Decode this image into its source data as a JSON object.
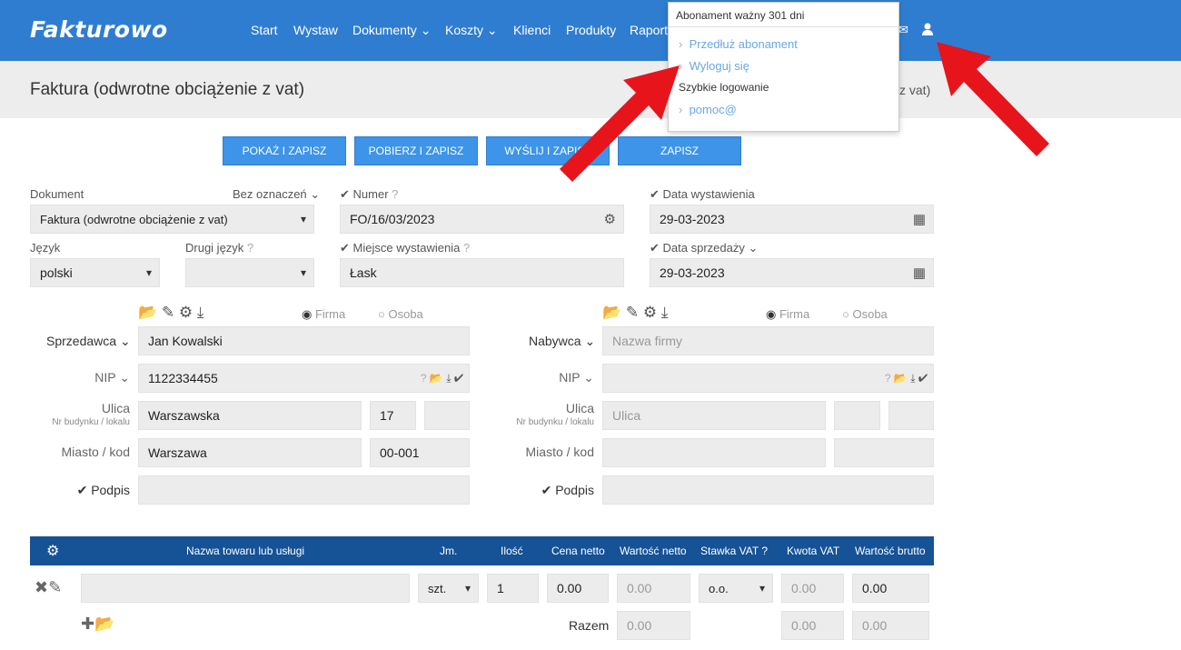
{
  "nav": {
    "logo": "Fakturowo",
    "items": [
      "Start",
      "Wystaw",
      "Dokumenty",
      "Koszty",
      "Klienci",
      "Produkty",
      "Raporty"
    ]
  },
  "page": {
    "title": "Faktura (odwrotne obciążenie z vat)",
    "title_right": "z vat)"
  },
  "buttons": {
    "show_save": "POKAŻ I ZAPISZ",
    "download_save": "POBIERZ I ZAPISZ",
    "send_save": "WYŚLIJ I ZAPISZ",
    "save": "ZAPISZ"
  },
  "form": {
    "dokument_label": "Dokument",
    "bez_oznaczen": "Bez oznaczeń",
    "dokument_value": "Faktura (odwrotne obciążenie z vat)",
    "jezyk_label": "Język",
    "jezyk_value": "polski",
    "drugi_jezyk_label": "Drugi język",
    "drugi_jezyk_value": "",
    "numer_label": "Numer",
    "numer_value": "FO/16/03/2023",
    "miejsce_label": "Miejsce wystawienia",
    "miejsce_value": "Łask",
    "data_wyst_label": "Data wystawienia",
    "data_wyst_value": "29-03-2023",
    "data_sprz_label": "Data sprzedaży",
    "data_sprz_value": "29-03-2023"
  },
  "seller": {
    "label": "Sprzedawca",
    "firma": "Firma",
    "osoba": "Osoba",
    "name": "Jan Kowalski",
    "nip_label": "NIP",
    "nip": "1122334455",
    "ulica_label": "Ulica",
    "nr_label": "Nr budynku / lokalu",
    "ulica": "Warszawska",
    "nr_budynku": "17",
    "nr_lokalu": "",
    "miasto_label": "Miasto / kod",
    "miasto": "Warszawa",
    "kod": "00-001",
    "podpis_label": "Podpis"
  },
  "buyer": {
    "label": "Nabywca",
    "firma": "Firma",
    "osoba": "Osoba",
    "name_placeholder": "Nazwa firmy",
    "nip_label": "NIP",
    "ulica_label": "Ulica",
    "nr_label": "Nr budynku / lokalu",
    "ulica_placeholder": "Ulica",
    "miasto_label": "Miasto / kod",
    "podpis_label": "Podpis"
  },
  "table": {
    "headers": [
      "Nazwa towaru lub usługi",
      "Jm.",
      "Ilość",
      "Cena netto",
      "Wartość netto",
      "Stawka VAT",
      "Kwota VAT",
      "Wartość brutto"
    ],
    "row": {
      "jm": "szt.",
      "ilosc": "1",
      "cena_netto": "0.00",
      "wartosc_netto": "0.00",
      "stawka": "o.o.",
      "kwota_vat": "0.00",
      "wartosc_brutto": "0.00"
    },
    "razem_label": "Razem",
    "razem_netto": "0.00",
    "razem_vat": "0.00",
    "razem_brutto": "0.00"
  },
  "dropdown": {
    "header": "Abonament ważny 301 dni",
    "extend": "Przedłuż abonament",
    "logout": "Wyloguj się",
    "quick_login": "Szybkie logowanie",
    "help": "pomoc@"
  },
  "colors": {
    "nav": "#2f7dd1",
    "button": "#3d94e8",
    "table_header": "#165296",
    "arrow": "#e8141c"
  }
}
